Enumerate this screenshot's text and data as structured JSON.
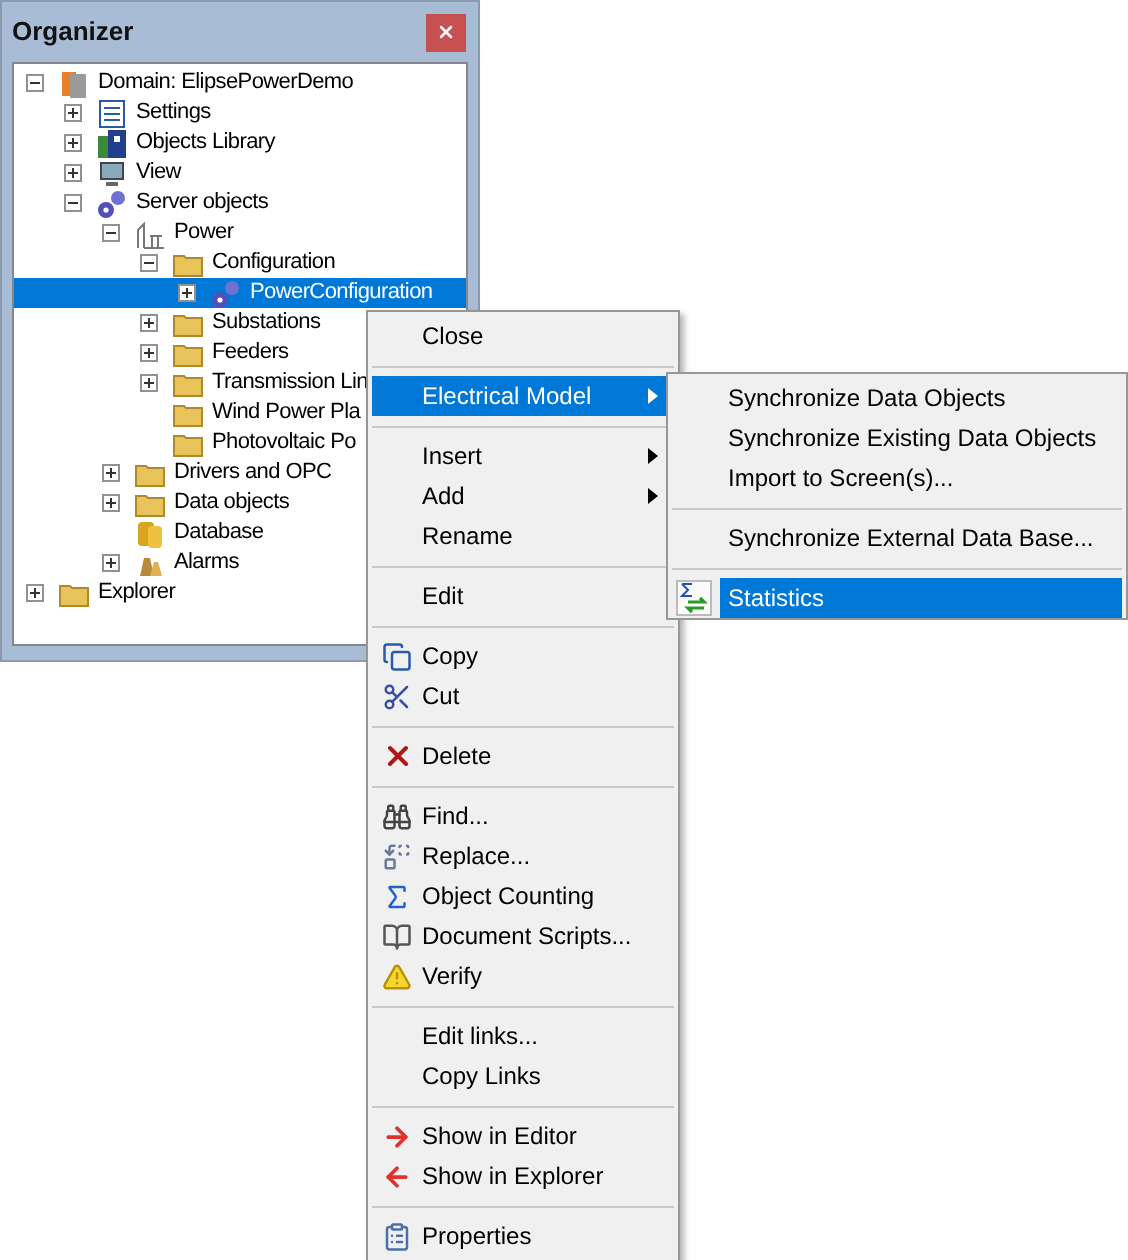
{
  "panel": {
    "title": "Organizer"
  },
  "tree": [
    {
      "label": "Domain: ElipsePowerDemo",
      "expanded": true,
      "selected": false,
      "children": [
        {
          "label": "Settings",
          "expanded": false,
          "selected": false
        },
        {
          "label": "Objects Library",
          "expanded": false,
          "selected": false
        },
        {
          "label": "View",
          "expanded": false,
          "selected": false
        },
        {
          "label": "Server objects",
          "expanded": true,
          "selected": false,
          "children": [
            {
              "label": "Power",
              "expanded": true,
              "selected": false,
              "children": [
                {
                  "label": "Configuration",
                  "expanded": true,
                  "selected": false,
                  "children": [
                    {
                      "label": "PowerConfiguration",
                      "expanded": false,
                      "selected": true
                    }
                  ]
                },
                {
                  "label": "Substations",
                  "expanded": false,
                  "selected": false
                },
                {
                  "label": "Feeders",
                  "expanded": false,
                  "selected": false
                },
                {
                  "label": "Transmission Lin",
                  "expanded": false,
                  "selected": false
                },
                {
                  "label": "Wind Power Pla",
                  "selected": false
                },
                {
                  "label": "Photovoltaic Po",
                  "selected": false
                }
              ]
            },
            {
              "label": "Drivers and OPC",
              "expanded": false,
              "selected": false
            },
            {
              "label": "Data objects",
              "expanded": false,
              "selected": false
            },
            {
              "label": "Database",
              "selected": false
            },
            {
              "label": "Alarms",
              "expanded": false,
              "selected": false
            }
          ]
        }
      ]
    },
    {
      "label": "Explorer",
      "expanded": false,
      "selected": false
    }
  ],
  "context_menu": [
    {
      "kind": "item",
      "label": "Close",
      "selected": false,
      "submenu": false
    },
    {
      "kind": "separator"
    },
    {
      "kind": "item",
      "label": "Electrical Model",
      "selected": true,
      "submenu": true
    },
    {
      "kind": "separator"
    },
    {
      "kind": "item",
      "label": "Insert",
      "selected": false,
      "submenu": true
    },
    {
      "kind": "item",
      "label": "Add",
      "selected": false,
      "submenu": true
    },
    {
      "kind": "item",
      "label": "Rename",
      "selected": false,
      "submenu": false
    },
    {
      "kind": "separator"
    },
    {
      "kind": "item",
      "label": "Edit",
      "selected": false,
      "submenu": false
    },
    {
      "kind": "separator"
    },
    {
      "kind": "item",
      "label": "Copy",
      "selected": false,
      "submenu": false
    },
    {
      "kind": "item",
      "label": "Cut",
      "selected": false,
      "submenu": false
    },
    {
      "kind": "separator"
    },
    {
      "kind": "item",
      "label": "Delete",
      "selected": false,
      "submenu": false
    },
    {
      "kind": "separator"
    },
    {
      "kind": "item",
      "label": "Find...",
      "selected": false,
      "submenu": false
    },
    {
      "kind": "item",
      "label": "Replace...",
      "selected": false,
      "submenu": false
    },
    {
      "kind": "item",
      "label": "Object Counting",
      "selected": false,
      "submenu": false
    },
    {
      "kind": "item",
      "label": "Document Scripts...",
      "selected": false,
      "submenu": false
    },
    {
      "kind": "item",
      "label": "Verify",
      "selected": false,
      "submenu": false
    },
    {
      "kind": "separator"
    },
    {
      "kind": "item",
      "label": "Edit links...",
      "selected": false,
      "submenu": false
    },
    {
      "kind": "item",
      "label": "Copy Links",
      "selected": false,
      "submenu": false
    },
    {
      "kind": "separator"
    },
    {
      "kind": "item",
      "label": "Show in Editor",
      "selected": false,
      "submenu": false
    },
    {
      "kind": "item",
      "label": "Show in Explorer",
      "selected": false,
      "submenu": false
    },
    {
      "kind": "separator"
    },
    {
      "kind": "item",
      "label": "Properties",
      "selected": false,
      "submenu": false
    }
  ],
  "submenu": [
    {
      "kind": "item",
      "label": "Synchronize Data Objects",
      "selected": false
    },
    {
      "kind": "item",
      "label": "Synchronize Existing Data Objects",
      "selected": false
    },
    {
      "kind": "item",
      "label": "Import to Screen(s)...",
      "selected": false
    },
    {
      "kind": "separator"
    },
    {
      "kind": "item",
      "label": "Synchronize External Data Base...",
      "selected": false
    },
    {
      "kind": "separator"
    },
    {
      "kind": "item",
      "label": "Statistics",
      "selected": true
    }
  ]
}
